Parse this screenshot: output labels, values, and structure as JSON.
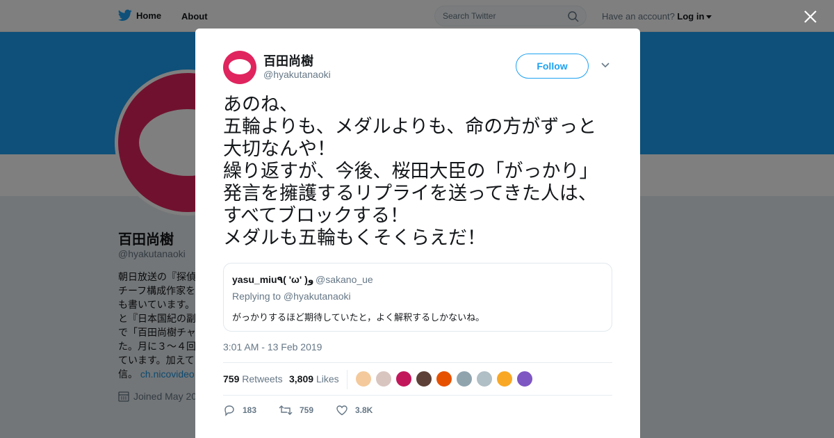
{
  "topbar": {
    "home_label": "Home",
    "about_label": "About",
    "search_placeholder": "Search Twitter",
    "account_prompt": "Have an account?",
    "login_label": "Log in",
    "brand_color": "#1da1f2"
  },
  "profile": {
    "name": "百田尚樹",
    "handle": "@hyakutanaoki",
    "bio_lines": [
      "朝日放送の『探偵",
      "チーフ構成作家を",
      "も書いています。",
      "と『日本国紀の副",
      "で「百田尚樹チャ",
      "た。月に３～４回",
      "ています。加えて",
      "信。"
    ],
    "bio_link": "ch.nicovideo",
    "joined": "Joined May 20",
    "avatar_color": "#e0245e"
  },
  "tweet": {
    "author_name": "百田尚樹",
    "author_handle": "@hyakutanaoki",
    "follow_label": "Follow",
    "text": "あのね、\n五輪よりも、メダルよりも、命の方がずっと\n大切なんや！\n繰り返すが、今後、桜田大臣の「がっかり」\n発言を擁護するリプライを送ってきた人は、\nすべてブロックする！\nメダルも五輪もくそくらえだ！",
    "quote": {
      "name": "yasu_miu٩( 'ω' )و",
      "handle": "@sakano_ue",
      "replying_to": "Replying to @hyakutanaoki",
      "text": "がっかりするほど期待していたと，よく解釈するしかないね。"
    },
    "timestamp": "3:01 AM - 13 Feb 2019",
    "stats": {
      "retweets_count": "759",
      "retweets_label": "Retweets",
      "likes_count": "3,809",
      "likes_label": "Likes"
    },
    "likers": [
      "#f4c99b",
      "#d9c5c0",
      "#c2185b",
      "#5d4037",
      "#e65100",
      "#90a4ae",
      "#b0bec5",
      "#f9a825",
      "#7e57c2"
    ],
    "actions": {
      "reply_count": "183",
      "retweet_count": "759",
      "like_count": "3.8K"
    }
  }
}
